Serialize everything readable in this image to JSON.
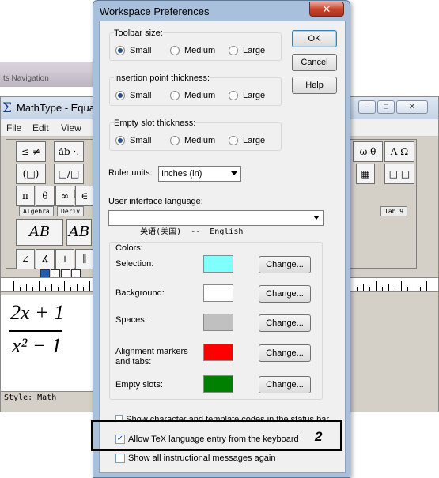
{
  "background_window": {
    "strip_label": "ts Navigation",
    "title": "MathType - Equa",
    "menu": [
      "File",
      "Edit",
      "View"
    ],
    "palette_top": [
      "≤ ≠ ≈",
      "ȧb ·.",
      "(□) [□]",
      "□/□ √□",
      "π",
      "θ",
      "∞",
      "∈",
      "ω θ",
      "Λ Ω ⊗",
      "▦",
      "□ □"
    ],
    "tabs": [
      "Algebra",
      "Deriv",
      "Tab 9"
    ],
    "templates": [
      "AB",
      "AB"
    ],
    "fraction": {
      "numerator": "2x + 1",
      "denominator": "x² − 1"
    },
    "status": "Style: Math"
  },
  "dialog": {
    "title": "Workspace Preferences",
    "close_label": "✕",
    "toolbar_size": {
      "label": "Toolbar size:",
      "options": [
        "Small",
        "Medium",
        "Large"
      ],
      "selected": "Small"
    },
    "insertion_thickness": {
      "label": "Insertion point thickness:",
      "options": [
        "Small",
        "Medium",
        "Large"
      ],
      "selected": "Small"
    },
    "empty_slot_thickness": {
      "label": "Empty slot thickness:",
      "options": [
        "Small",
        "Medium",
        "Large"
      ],
      "selected": "Small"
    },
    "ruler_units": {
      "label": "Ruler units:",
      "value": "Inches (in)"
    },
    "ui_language": {
      "label": "User interface language:",
      "value": "英语(美国)  --  English"
    },
    "colors": {
      "label": "Colors:",
      "items": [
        {
          "label": "Selection:",
          "color": "#80ffff",
          "button": "Change..."
        },
        {
          "label": "Background:",
          "color": "#ffffff",
          "button": "Change..."
        },
        {
          "label": "Spaces:",
          "color": "#c0c0c0",
          "button": "Change..."
        },
        {
          "label": "Alignment markers\nand tabs:",
          "color": "#ff0000",
          "button": "Change..."
        },
        {
          "label": "Empty slots:",
          "color": "#008000",
          "button": "Change..."
        }
      ]
    },
    "checkbox_partial": "Show character and template codes in the status bar",
    "checkbox_tex": {
      "label": "Allow TeX language entry from the keyboard",
      "checked": true
    },
    "checkbox_messages": {
      "label": "Show all instructional messages again",
      "checked": false
    },
    "buttons": {
      "ok": "OK",
      "cancel": "Cancel",
      "help": "Help"
    }
  },
  "annotation": {
    "number": "2"
  }
}
